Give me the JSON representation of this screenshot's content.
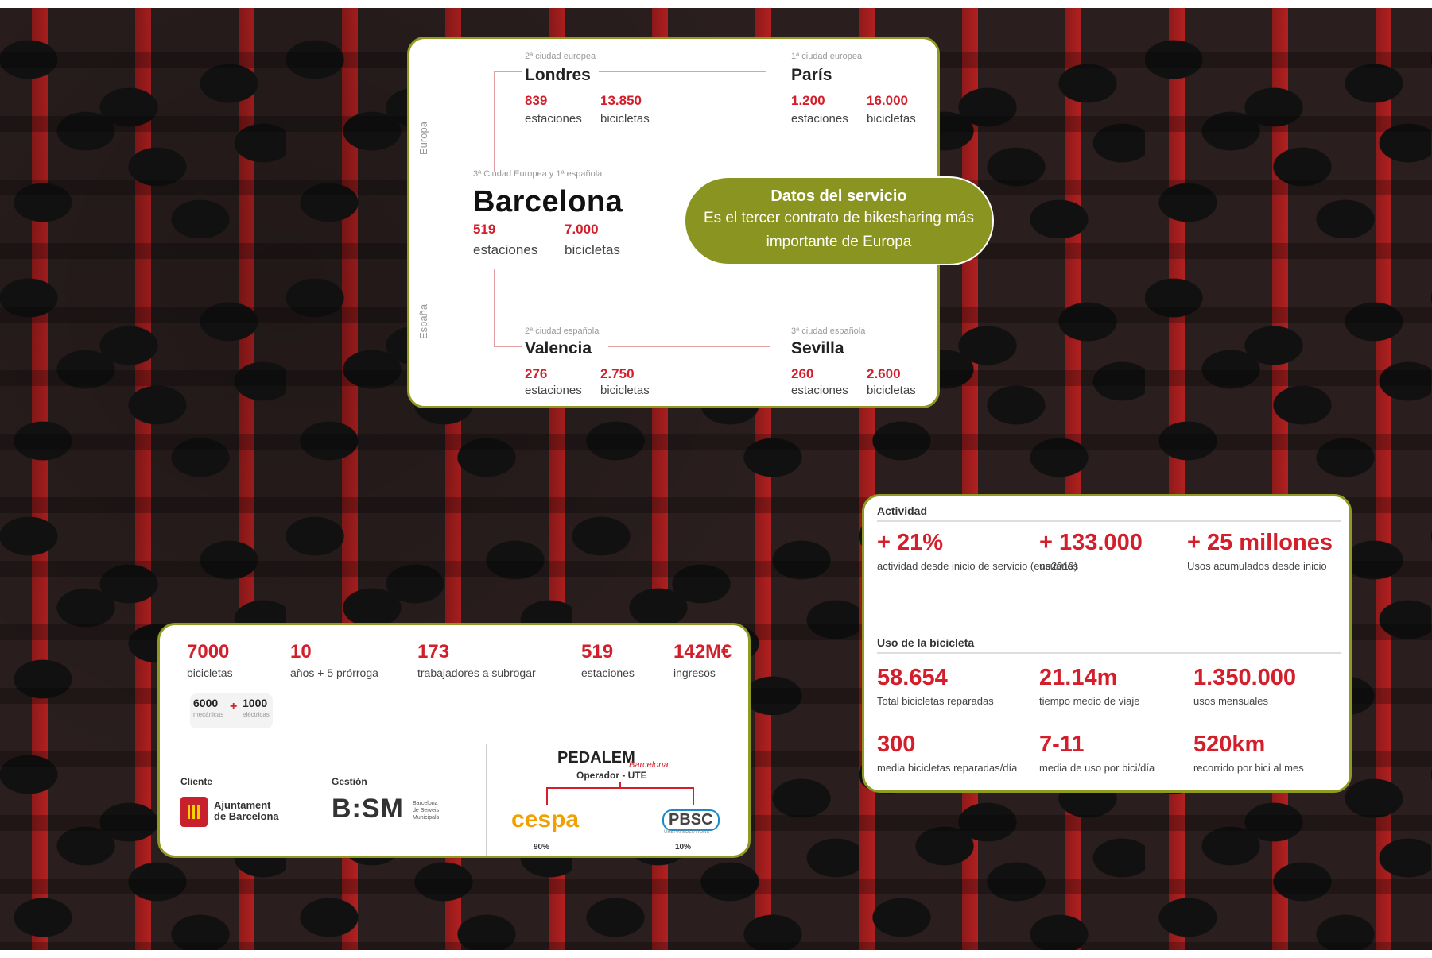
{
  "map_card": {
    "europe_label": "Europa",
    "spain_label": "España",
    "london": {
      "rank": "2ª ciudad europea",
      "name": "Londres",
      "stations": "839",
      "stations_label": "estaciones",
      "bikes": "13.850",
      "bikes_label": "bicicletas"
    },
    "paris": {
      "rank": "1ª ciudad europea",
      "name": "París",
      "stations": "1.200",
      "stations_label": "estaciones",
      "bikes": "16.000",
      "bikes_label": "bicicletas"
    },
    "barcelona": {
      "rank": "3ª Ciudad Europea y 1ª española",
      "name": "Barcelona",
      "stations": "519",
      "stations_label": "estaciones",
      "bikes": "7.000",
      "bikes_label": "bicicletas"
    },
    "valencia": {
      "rank": "2ª ciudad española",
      "name": "Valencia",
      "stations": "276",
      "stations_label": "estaciones",
      "bikes": "2.750",
      "bikes_label": "bicicletas"
    },
    "sevilla": {
      "rank": "3ª ciudad española",
      "name": "Sevilla",
      "stations": "260",
      "stations_label": "estaciones",
      "bikes": "2.600",
      "bikes_label": "bicicletas"
    }
  },
  "bubble": {
    "title": "Datos del servicio",
    "line1": "Es el tercer contrato de bikesharing más",
    "line2": "importante de Europa"
  },
  "service_card": {
    "stats": [
      {
        "value": "7000",
        "label": "bicicletas"
      },
      {
        "value": "10",
        "label": "años + 5 prórroga"
      },
      {
        "value": "173",
        "label": "trabajadores a subrogar"
      },
      {
        "value": "519",
        "label": "estaciones"
      },
      {
        "value": "142M€",
        "label": "ingresos"
      }
    ],
    "mechanical": {
      "value": "6000",
      "label": "mecánicas"
    },
    "plus": "+",
    "electric": {
      "value": "1000",
      "label": "eléctricas"
    },
    "client_label": "Cliente",
    "client_name_1": "Ajuntament",
    "client_name_2": "de Barcelona",
    "management_label": "Gestión",
    "bsm_logo": "B:SM",
    "bsm_sub_1": "Barcelona",
    "bsm_sub_2": "de Serveis",
    "bsm_sub_3": "Municipals",
    "pedalem_logo": "PEDALEM",
    "pedalem_sub": "Barcelona",
    "operator_label": "Operador - UTE",
    "cespa_logo": "cespa",
    "cespa_share": "90%",
    "pbsc_logo": "PBSC",
    "pbsc_sub": "URBAN SOLUTIONS",
    "pbsc_share": "10%"
  },
  "activity_card": {
    "activity_title": "Actividad",
    "activity": [
      {
        "value": "+ 21%",
        "label": "actividad desde inicio de servicio (ene2019)"
      },
      {
        "value": "+ 133.000",
        "label": "usuarios"
      },
      {
        "value": "+ 25 millones",
        "label": "Usos acumulados desde inicio"
      }
    ],
    "usage_title": "Uso de la bicicleta",
    "usage": [
      {
        "value": "58.654",
        "label": "Total bicicletas reparadas"
      },
      {
        "value": "21.14m",
        "label": "tiempo medio de viaje"
      },
      {
        "value": "1.350.000",
        "label": "usos mensuales"
      },
      {
        "value": "300",
        "label": "media bicicletas reparadas/día"
      },
      {
        "value": "7-11",
        "label": "media de uso por bici/día"
      },
      {
        "value": "520km",
        "label": "recorrido por bici al mes"
      }
    ]
  },
  "colors": {
    "accent_olive": "#8a9420",
    "brand_red": "#d21f2b"
  }
}
